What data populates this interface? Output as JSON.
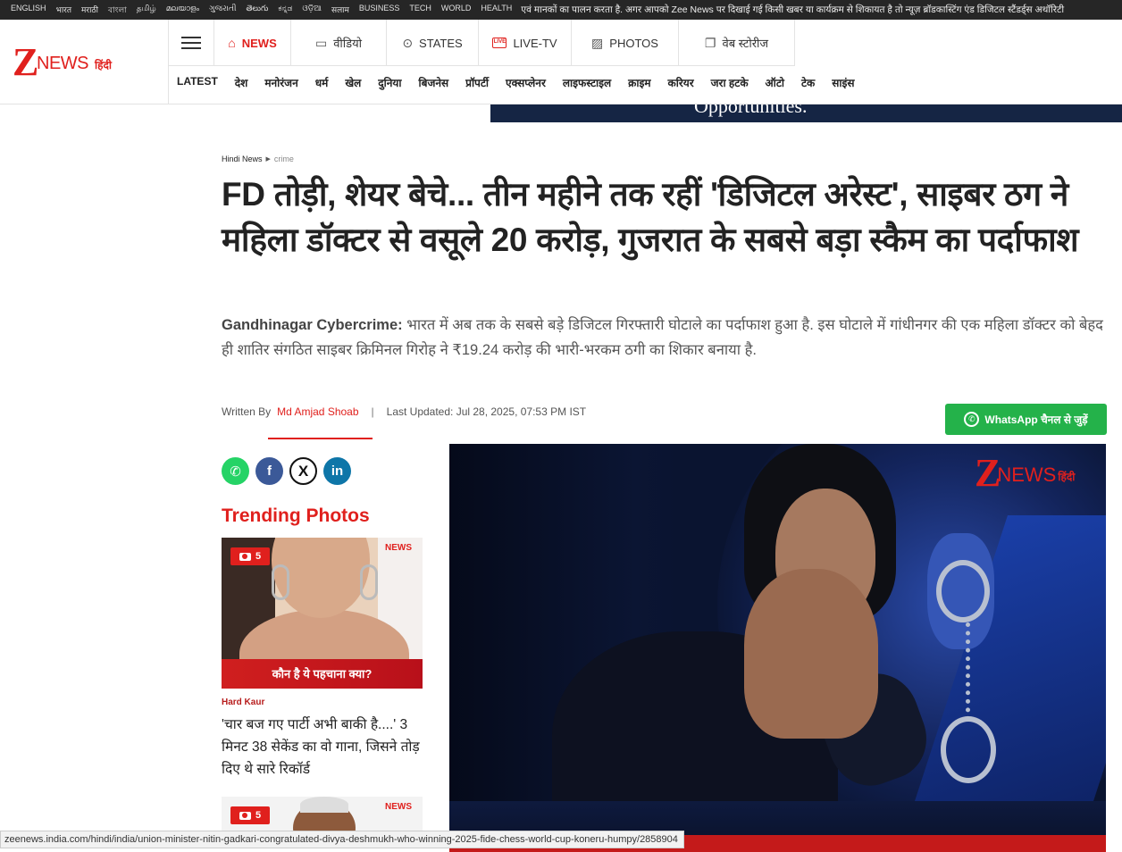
{
  "topbar": {
    "languages": [
      "ENGLISH",
      "भारत",
      "मराठी",
      "বাংলা",
      "தமிழ்",
      "മലയാളം",
      "ગુજરાતી",
      "తెలుగు",
      "ಕನ್ನಡ",
      "ଓଡ଼ିଆ",
      "सलाम",
      "BUSINESS",
      "TECH",
      "WORLD",
      "HEALTH"
    ],
    "ticker": "एवं मानकों का पालन करता है. अगर आपको Zee News पर दिखाई गई किसी खबर या कार्यक्रम से शिकायत है तो न्यूज़ ब्रॉडकास्टिंग एंड डिजिटल स्टैंडर्ड्स अथॉरिटी"
  },
  "logo": {
    "z": "Z",
    "news": "NEWS",
    "hindi": "हिंदी"
  },
  "menu": {
    "news": "NEWS",
    "video": "वीडियो",
    "states": "STATES",
    "live": "LIVE-TV",
    "live_icon": "LIVE",
    "photos": "PHOTOS",
    "web_stories": "वेब स्टोरीज"
  },
  "subnav": [
    "LATEST",
    "देश",
    "मनोरंजन",
    "धर्म",
    "खेल",
    "दुनिया",
    "बिजनेस",
    "प्रॉपर्टी",
    "एक्सप्लेनर",
    "लाइफस्टाइल",
    "क्राइम",
    "करियर",
    "जरा हटके",
    "ऑटो",
    "टेक",
    "साइंस"
  ],
  "ad": {
    "text": "Opportunities."
  },
  "breadcrumb": {
    "home": "Hindi News",
    "section": "crime"
  },
  "article": {
    "title": "FD तोड़ी, शेयर बेचे... तीन महीने तक रहीं 'डिजिटल अरेस्ट', साइबर ठग ने महिला डॉक्टर से वसूले 20 करोड़, गुजरात के सबसे बड़ा स्कैम का पर्दाफाश",
    "summary_lead": "Gandhinagar Cybercrime:",
    "summary": " भारत में अब तक के सबसे बड़े डिजिटल गिरफ्तारी घोटाले का पर्दाफाश हुआ है. इस घोटाले में गांधीनगर की एक महिला डॉक्टर को बेहद ही शातिर संगठित साइबर क्रिमिनल गिरोह ने ₹19.24 करोड़ की भारी-भरकम ठगी का शिकार बनाया है.",
    "written_by": "Written By",
    "author": "Md Amjad Shoab",
    "separator": "|",
    "updated": "Last Updated: Jul 28, 2025, 07:53 PM IST"
  },
  "whatsapp": {
    "label": "WhatsApp चैनल से जुड़ें"
  },
  "share": {
    "facebook": "f",
    "x": "X",
    "linkedin": "in"
  },
  "trending": {
    "title": "Trending Photos",
    "cards": [
      {
        "count": "5",
        "caption": "कौन है ये पहचाना क्या?",
        "category": "Hard Kaur",
        "text": "'चार बज गए पार्टी अभी बाकी है....' 3 मिनट 38 सेकेंड का वो गाना, जिसने तोड़ दिए थे सारे रिकॉर्ड",
        "watermark": "NEWS"
      },
      {
        "count": "5",
        "watermark": "NEWS"
      }
    ]
  },
  "hero": {
    "wm_z": "Z",
    "wm_news": "NEWS",
    "wm_hindi": "हिंदी"
  },
  "statusbar": {
    "url": "zeenews.india.com/hindi/india/union-minister-nitin-gadkari-congratulated-divya-deshmukh-who-winning-2025-fide-chess-world-cup-koneru-humpy/2858904"
  },
  "colors": {
    "brand_red": "#e0201d",
    "whatsapp_green": "#24b24a",
    "facebook": "#3b5998",
    "linkedin": "#0e76a8"
  }
}
